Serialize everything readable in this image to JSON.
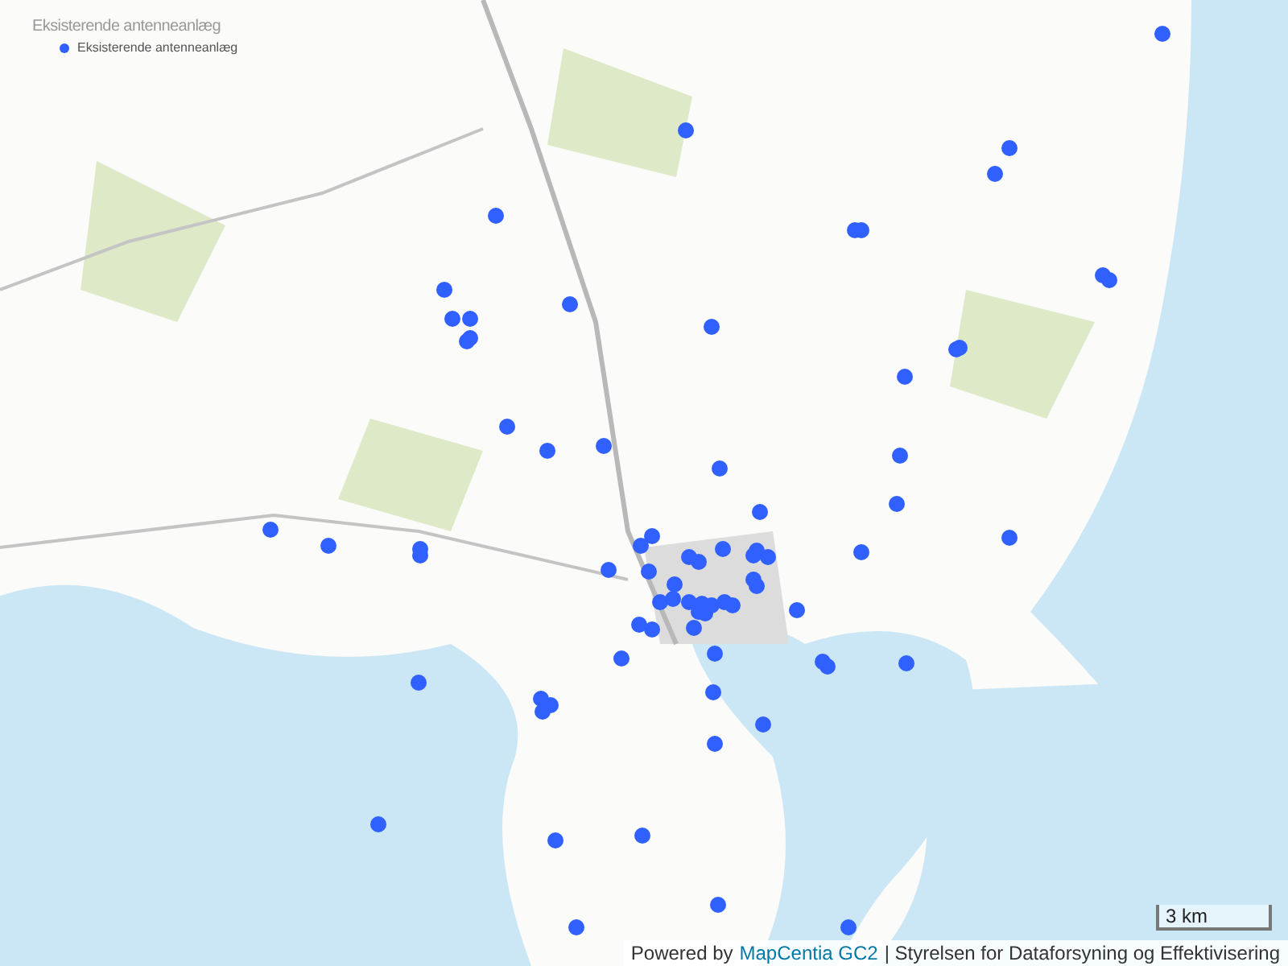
{
  "legend": {
    "title": "Eksisterende antenneanlæg",
    "items": [
      {
        "label": "Eksisterende antenneanlæg",
        "color": "#3060ff"
      }
    ]
  },
  "scale_bar": {
    "label": "3 km"
  },
  "attribution": {
    "prefix": "Powered by",
    "link": "MapCentia GC2",
    "suffix": "| Styrelsen for Dataforsyning og Effektivisering"
  }
}
